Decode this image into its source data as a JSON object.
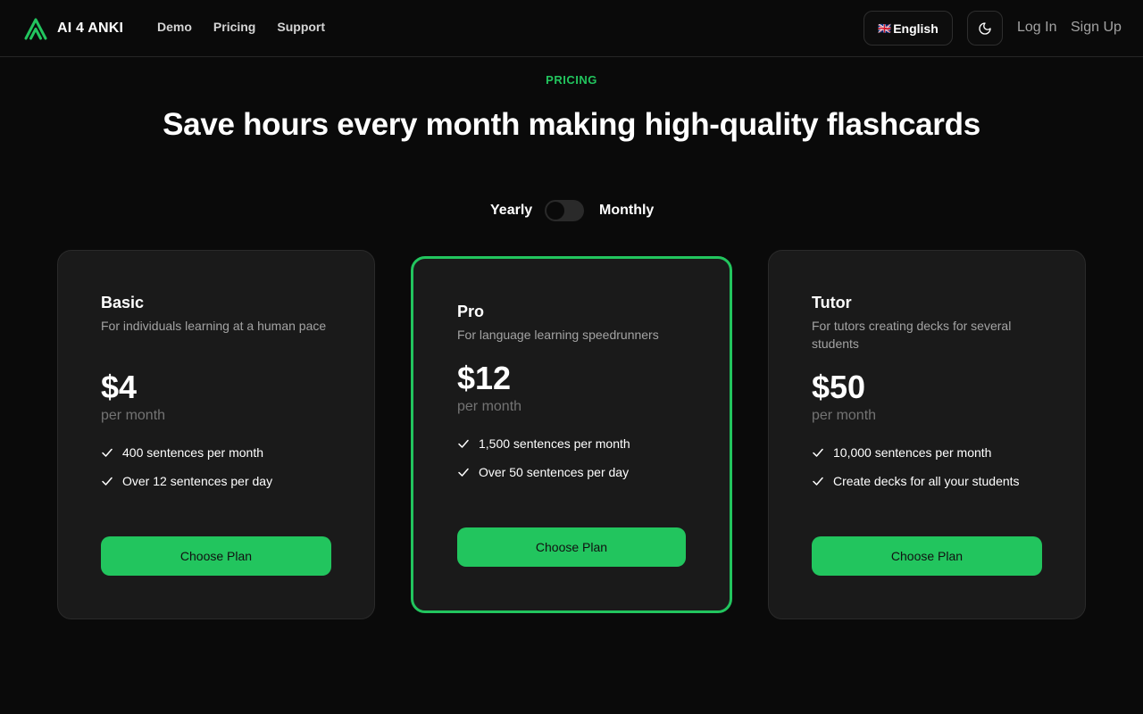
{
  "brand": {
    "name": "AI 4 ANKI",
    "logo_icon": "anki-triangle-logo",
    "accent": "#22c55e"
  },
  "nav": {
    "demo": "Demo",
    "pricing": "Pricing",
    "support": "Support"
  },
  "header": {
    "language": "English",
    "flag_icon": "🇬🇧",
    "theme_icon": "moon-icon",
    "login": "Log In",
    "signup": "Sign Up"
  },
  "hero": {
    "eyebrow": "PRICING",
    "title": "Save hours every month making high-quality flashcards"
  },
  "billing": {
    "yearly": "Yearly",
    "monthly": "Monthly",
    "monthly_selected": false
  },
  "plans": [
    {
      "name": "Basic",
      "description": "For individuals learning at a human pace",
      "price": "$4",
      "period": "per month",
      "features": [
        "400 sentences per month",
        "Over 12 sentences per day"
      ],
      "cta": "Choose Plan",
      "highlighted": false
    },
    {
      "name": "Pro",
      "description": "For language learning speedrunners",
      "price": "$12",
      "period": "per month",
      "features": [
        "1,500 sentences per month",
        "Over 50 sentences per day"
      ],
      "cta": "Choose Plan",
      "highlighted": true
    },
    {
      "name": "Tutor",
      "description": "For tutors creating decks for several students",
      "price": "$50",
      "period": "per month",
      "features": [
        "10,000 sentences per month",
        "Create decks for all your students"
      ],
      "cta": "Choose Plan",
      "highlighted": false
    }
  ]
}
